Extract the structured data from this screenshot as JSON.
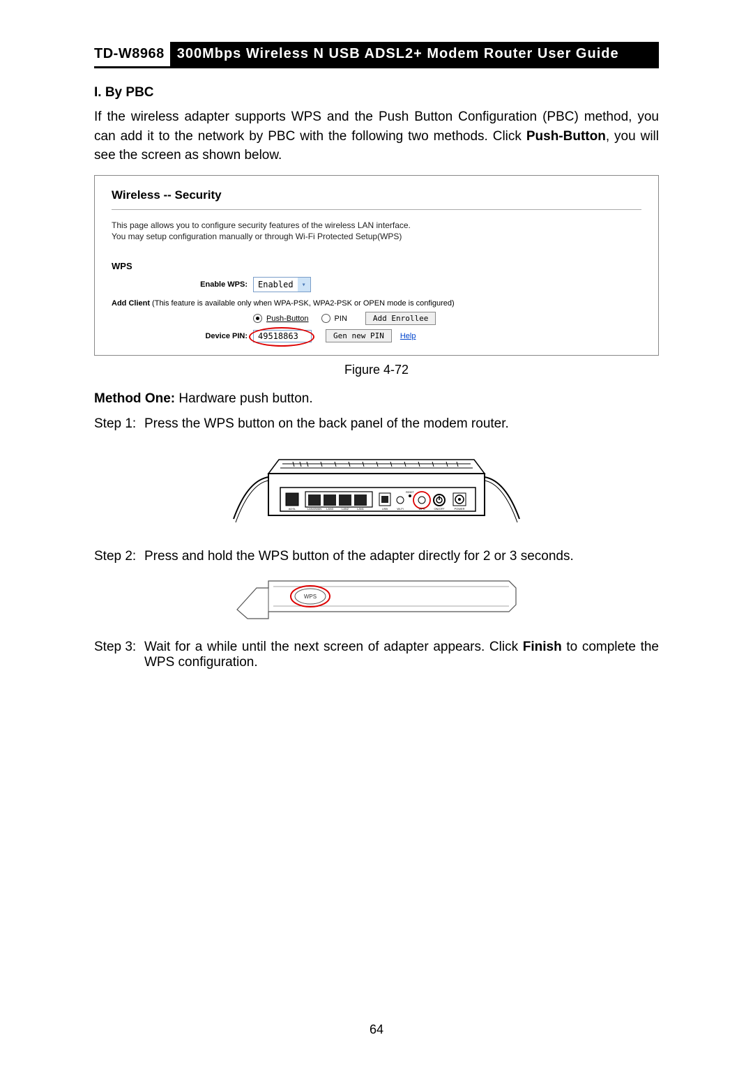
{
  "header": {
    "model": "TD-W8968",
    "title": "300Mbps Wireless N USB ADSL2+ Modem Router User Guide"
  },
  "section": {
    "heading": "I.  By PBC",
    "intro_pre": "If the wireless adapter supports WPS and the Push Button Configuration (PBC) method, you can add it to the network by PBC with the following two methods. Click ",
    "intro_bold": "Push-Button",
    "intro_post": ", you will see the screen as shown below."
  },
  "screenshot": {
    "title": "Wireless -- Security",
    "desc_line1": "This page allows you to configure security features of the wireless LAN interface.",
    "desc_line2": "You may setup configuration manually or through Wi-Fi Protected Setup(WPS)",
    "wps_heading": "WPS",
    "enable_wps_label": "Enable WPS:",
    "enable_wps_value": "Enabled",
    "add_client_bold": "Add Client",
    "add_client_rest": " (This feature is available only when WPA-PSK, WPA2-PSK or OPEN mode is configured)",
    "radio_push": "Push-Button",
    "radio_pin": "PIN",
    "add_enrollee_btn": "Add Enrollee",
    "device_pin_label": "Device PIN:",
    "device_pin_value": "49518863",
    "gen_pin_btn": "Gen new PIN",
    "help_link": "Help"
  },
  "figure_caption": "Figure 4-72",
  "method_one": {
    "bold": "Method One:",
    "rest": " Hardware push button."
  },
  "steps": {
    "s1_label": "Step 1:",
    "s1_text": "Press the WPS button on the back panel of the modem router.",
    "s2_label": "Step 2:",
    "s2_text": "Press and hold the WPS button of the adapter directly for 2 or 3 seconds.",
    "s3_label": "Step 3:",
    "s3_text_pre": "Wait for a while until the next screen of adapter appears. Click ",
    "s3_text_bold": "Finish",
    "s3_text_post": " to complete the WPS configuration."
  },
  "router_ports": {
    "adsl": "ADSL",
    "lan4": "LAN4/WAN",
    "lan3": "LAN3",
    "lan2": "LAN2",
    "lan1": "LAN1",
    "usb": "USB",
    "wifi": "Wi-Fi",
    "reset": "RESET",
    "wps": "WPS",
    "onoff": "ON/OFF",
    "power": "POWER"
  },
  "adapter_label": "WPS",
  "page_number": "64"
}
